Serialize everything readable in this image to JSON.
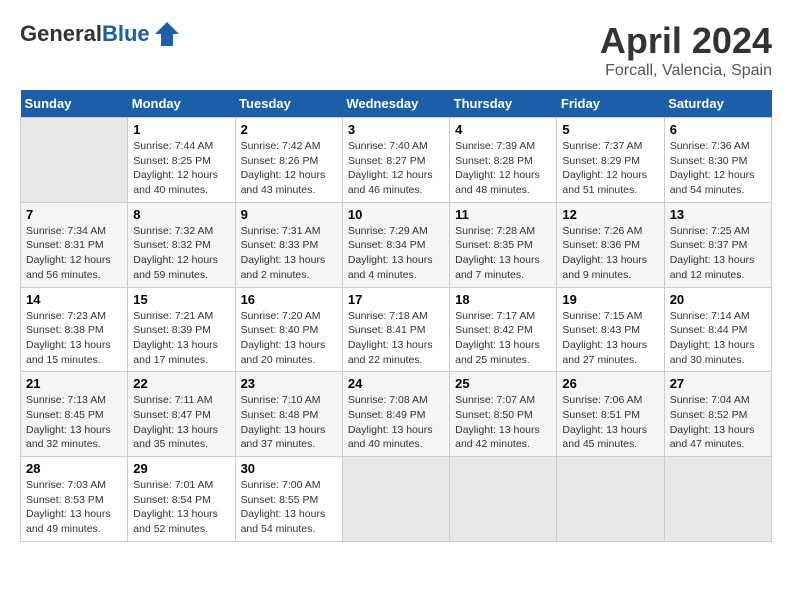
{
  "header": {
    "logo_general": "General",
    "logo_blue": "Blue",
    "title": "April 2024",
    "subtitle": "Forcall, Valencia, Spain"
  },
  "days_of_week": [
    "Sunday",
    "Monday",
    "Tuesday",
    "Wednesday",
    "Thursday",
    "Friday",
    "Saturday"
  ],
  "weeks": [
    [
      {
        "day": "",
        "sunrise": "",
        "sunset": "",
        "daylight": ""
      },
      {
        "day": "1",
        "sunrise": "Sunrise: 7:44 AM",
        "sunset": "Sunset: 8:25 PM",
        "daylight": "Daylight: 12 hours and 40 minutes."
      },
      {
        "day": "2",
        "sunrise": "Sunrise: 7:42 AM",
        "sunset": "Sunset: 8:26 PM",
        "daylight": "Daylight: 12 hours and 43 minutes."
      },
      {
        "day": "3",
        "sunrise": "Sunrise: 7:40 AM",
        "sunset": "Sunset: 8:27 PM",
        "daylight": "Daylight: 12 hours and 46 minutes."
      },
      {
        "day": "4",
        "sunrise": "Sunrise: 7:39 AM",
        "sunset": "Sunset: 8:28 PM",
        "daylight": "Daylight: 12 hours and 48 minutes."
      },
      {
        "day": "5",
        "sunrise": "Sunrise: 7:37 AM",
        "sunset": "Sunset: 8:29 PM",
        "daylight": "Daylight: 12 hours and 51 minutes."
      },
      {
        "day": "6",
        "sunrise": "Sunrise: 7:36 AM",
        "sunset": "Sunset: 8:30 PM",
        "daylight": "Daylight: 12 hours and 54 minutes."
      }
    ],
    [
      {
        "day": "7",
        "sunrise": "Sunrise: 7:34 AM",
        "sunset": "Sunset: 8:31 PM",
        "daylight": "Daylight: 12 hours and 56 minutes."
      },
      {
        "day": "8",
        "sunrise": "Sunrise: 7:32 AM",
        "sunset": "Sunset: 8:32 PM",
        "daylight": "Daylight: 12 hours and 59 minutes."
      },
      {
        "day": "9",
        "sunrise": "Sunrise: 7:31 AM",
        "sunset": "Sunset: 8:33 PM",
        "daylight": "Daylight: 13 hours and 2 minutes."
      },
      {
        "day": "10",
        "sunrise": "Sunrise: 7:29 AM",
        "sunset": "Sunset: 8:34 PM",
        "daylight": "Daylight: 13 hours and 4 minutes."
      },
      {
        "day": "11",
        "sunrise": "Sunrise: 7:28 AM",
        "sunset": "Sunset: 8:35 PM",
        "daylight": "Daylight: 13 hours and 7 minutes."
      },
      {
        "day": "12",
        "sunrise": "Sunrise: 7:26 AM",
        "sunset": "Sunset: 8:36 PM",
        "daylight": "Daylight: 13 hours and 9 minutes."
      },
      {
        "day": "13",
        "sunrise": "Sunrise: 7:25 AM",
        "sunset": "Sunset: 8:37 PM",
        "daylight": "Daylight: 13 hours and 12 minutes."
      }
    ],
    [
      {
        "day": "14",
        "sunrise": "Sunrise: 7:23 AM",
        "sunset": "Sunset: 8:38 PM",
        "daylight": "Daylight: 13 hours and 15 minutes."
      },
      {
        "day": "15",
        "sunrise": "Sunrise: 7:21 AM",
        "sunset": "Sunset: 8:39 PM",
        "daylight": "Daylight: 13 hours and 17 minutes."
      },
      {
        "day": "16",
        "sunrise": "Sunrise: 7:20 AM",
        "sunset": "Sunset: 8:40 PM",
        "daylight": "Daylight: 13 hours and 20 minutes."
      },
      {
        "day": "17",
        "sunrise": "Sunrise: 7:18 AM",
        "sunset": "Sunset: 8:41 PM",
        "daylight": "Daylight: 13 hours and 22 minutes."
      },
      {
        "day": "18",
        "sunrise": "Sunrise: 7:17 AM",
        "sunset": "Sunset: 8:42 PM",
        "daylight": "Daylight: 13 hours and 25 minutes."
      },
      {
        "day": "19",
        "sunrise": "Sunrise: 7:15 AM",
        "sunset": "Sunset: 8:43 PM",
        "daylight": "Daylight: 13 hours and 27 minutes."
      },
      {
        "day": "20",
        "sunrise": "Sunrise: 7:14 AM",
        "sunset": "Sunset: 8:44 PM",
        "daylight": "Daylight: 13 hours and 30 minutes."
      }
    ],
    [
      {
        "day": "21",
        "sunrise": "Sunrise: 7:13 AM",
        "sunset": "Sunset: 8:45 PM",
        "daylight": "Daylight: 13 hours and 32 minutes."
      },
      {
        "day": "22",
        "sunrise": "Sunrise: 7:11 AM",
        "sunset": "Sunset: 8:47 PM",
        "daylight": "Daylight: 13 hours and 35 minutes."
      },
      {
        "day": "23",
        "sunrise": "Sunrise: 7:10 AM",
        "sunset": "Sunset: 8:48 PM",
        "daylight": "Daylight: 13 hours and 37 minutes."
      },
      {
        "day": "24",
        "sunrise": "Sunrise: 7:08 AM",
        "sunset": "Sunset: 8:49 PM",
        "daylight": "Daylight: 13 hours and 40 minutes."
      },
      {
        "day": "25",
        "sunrise": "Sunrise: 7:07 AM",
        "sunset": "Sunset: 8:50 PM",
        "daylight": "Daylight: 13 hours and 42 minutes."
      },
      {
        "day": "26",
        "sunrise": "Sunrise: 7:06 AM",
        "sunset": "Sunset: 8:51 PM",
        "daylight": "Daylight: 13 hours and 45 minutes."
      },
      {
        "day": "27",
        "sunrise": "Sunrise: 7:04 AM",
        "sunset": "Sunset: 8:52 PM",
        "daylight": "Daylight: 13 hours and 47 minutes."
      }
    ],
    [
      {
        "day": "28",
        "sunrise": "Sunrise: 7:03 AM",
        "sunset": "Sunset: 8:53 PM",
        "daylight": "Daylight: 13 hours and 49 minutes."
      },
      {
        "day": "29",
        "sunrise": "Sunrise: 7:01 AM",
        "sunset": "Sunset: 8:54 PM",
        "daylight": "Daylight: 13 hours and 52 minutes."
      },
      {
        "day": "30",
        "sunrise": "Sunrise: 7:00 AM",
        "sunset": "Sunset: 8:55 PM",
        "daylight": "Daylight: 13 hours and 54 minutes."
      },
      {
        "day": "",
        "sunrise": "",
        "sunset": "",
        "daylight": ""
      },
      {
        "day": "",
        "sunrise": "",
        "sunset": "",
        "daylight": ""
      },
      {
        "day": "",
        "sunrise": "",
        "sunset": "",
        "daylight": ""
      },
      {
        "day": "",
        "sunrise": "",
        "sunset": "",
        "daylight": ""
      }
    ]
  ]
}
